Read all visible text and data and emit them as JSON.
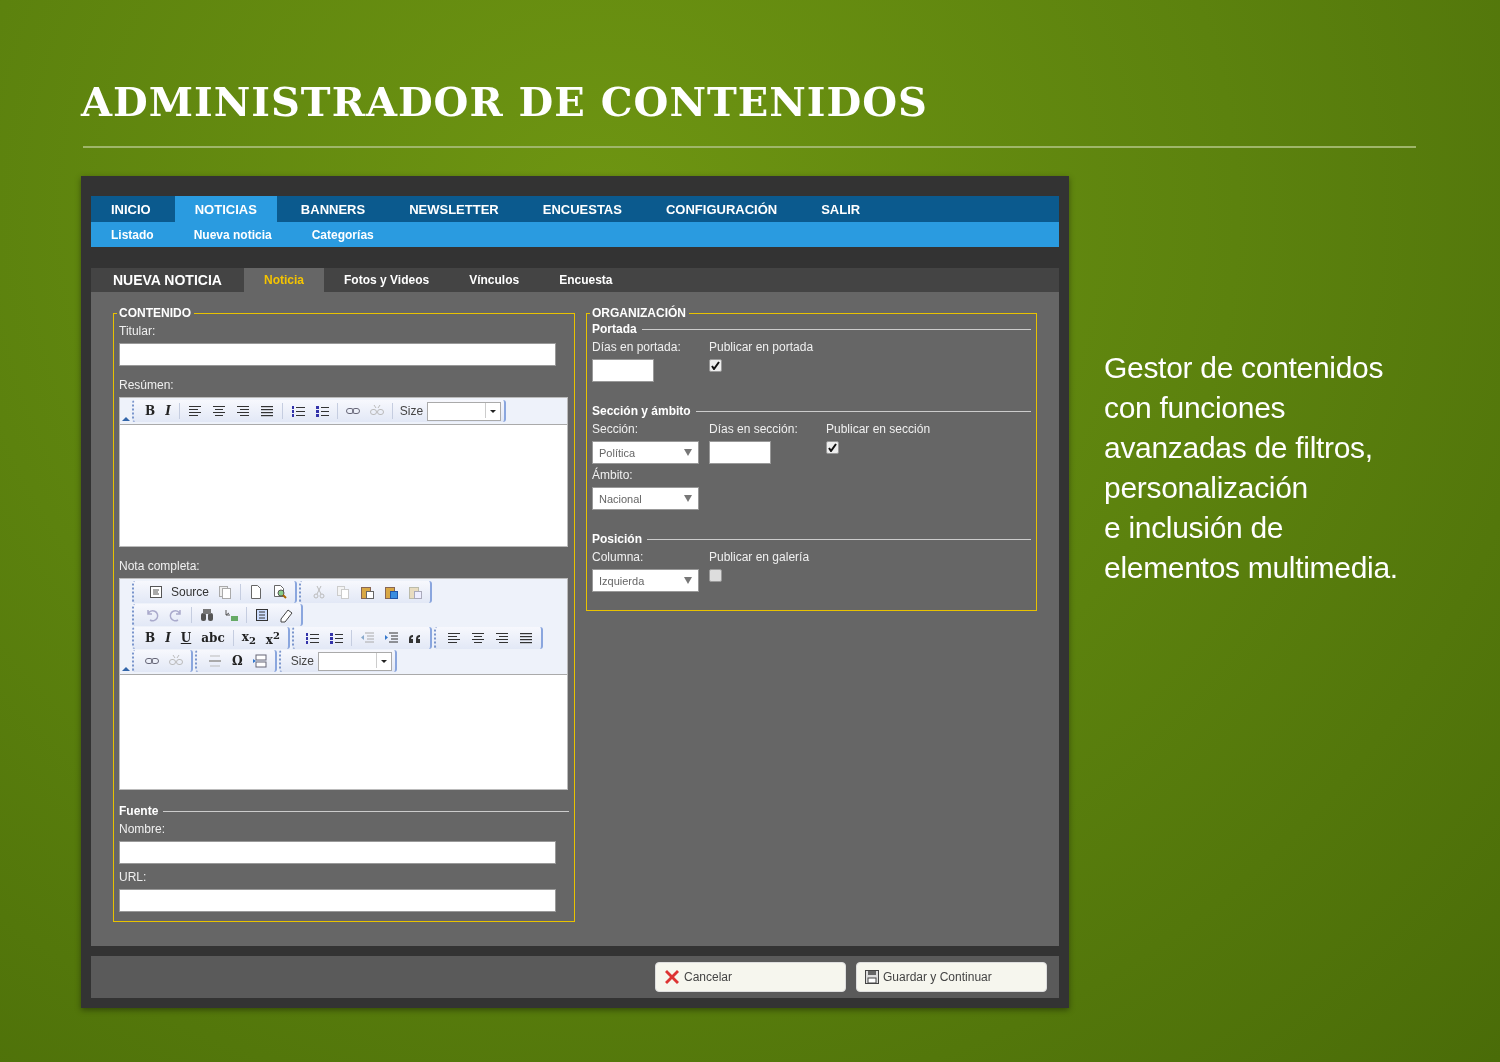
{
  "title": "ADMINISTRADOR DE CONTENIDOS",
  "tagline": [
    "Gestor de contenidos",
    "con funciones",
    "avanzadas de filtros,",
    "personalización",
    "e inclusión de",
    "elementos multimedia."
  ],
  "nav": {
    "main": [
      {
        "label": "INICIO",
        "selected": false
      },
      {
        "label": "NOTICIAS",
        "selected": true
      },
      {
        "label": "BANNERS",
        "selected": false
      },
      {
        "label": "NEWSLETTER",
        "selected": false
      },
      {
        "label": "ENCUESTAS",
        "selected": false
      },
      {
        "label": "CONFIGURACIÓN",
        "selected": false
      },
      {
        "label": "SALIR",
        "selected": false
      }
    ],
    "sub": [
      "Listado",
      "Nueva noticia",
      "Categorías"
    ]
  },
  "page_tabs": {
    "title": "NUEVA NOTICIA",
    "tabs": [
      {
        "label": "Noticia",
        "selected": true
      },
      {
        "label": "Fotos y Videos",
        "selected": false
      },
      {
        "label": "Vínculos",
        "selected": false
      },
      {
        "label": "Encuesta",
        "selected": false
      }
    ]
  },
  "contenido": {
    "legend": "CONTENIDO",
    "titular_label": "Titular:",
    "resumen_label": "Resúmen:",
    "resumen_toolbar": {
      "glyphs": [
        "B",
        "I"
      ],
      "size_label": "Size"
    },
    "nota_label": "Nota completa:",
    "nota_toolbar": {
      "source": "Source",
      "glyphs": [
        "B",
        "I",
        "U",
        "abc",
        "x$_{2}$",
        "x$^{2}$",
        "Ω"
      ],
      "size_label": "Size"
    },
    "fuente": {
      "legend": "Fuente",
      "fields": [
        {
          "label": "Nombre:"
        },
        {
          "label": "URL:"
        }
      ]
    }
  },
  "organizacion": {
    "legend": "ORGANIZACIÓN",
    "sections": [
      {
        "legend": "Portada",
        "rows": [
          [
            {
              "kind": "input",
              "label": "Días en portada:"
            },
            {
              "kind": "checkbox",
              "label": "Publicar en portada",
              "checked": true
            }
          ]
        ]
      },
      {
        "legend": "Sección y ámbito",
        "rows": [
          [
            {
              "kind": "select",
              "label": "Sección:",
              "value": "Política"
            },
            {
              "kind": "input",
              "label": "Días en sección:"
            },
            {
              "kind": "checkbox",
              "label": "Publicar en sección",
              "checked": true
            }
          ],
          [
            {
              "kind": "select",
              "label": "Ámbito:",
              "value": "Nacional"
            }
          ]
        ]
      },
      {
        "legend": "Posición",
        "rows": [
          [
            {
              "kind": "select",
              "label": "Columna:",
              "value": "Izquierda"
            },
            {
              "kind": "checkbox",
              "label": "Publicar en galería",
              "checked": false
            }
          ]
        ]
      }
    ]
  },
  "buttons": [
    {
      "kind": "cancel",
      "label": "Cancelar"
    },
    {
      "kind": "save",
      "label": "Guardar y Continuar"
    }
  ]
}
